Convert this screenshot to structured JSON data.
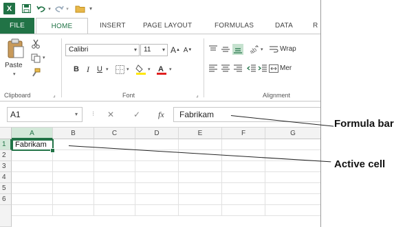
{
  "qat": {
    "app_icon": "X",
    "save_icon": "save-icon",
    "undo_icon": "undo-icon",
    "redo_icon": "redo-icon",
    "open_icon": "folder-icon"
  },
  "tabs": [
    "FILE",
    "HOME",
    "INSERT",
    "PAGE LAYOUT",
    "FORMULAS",
    "DATA",
    "R"
  ],
  "ribbon": {
    "paste_label": "Paste",
    "font_name": "Calibri",
    "font_size": "11",
    "grow_font": "A",
    "shrink_font": "A",
    "bold": "B",
    "italic": "I",
    "underline": "U",
    "wrap_text": "Wrap",
    "merge": "Mer",
    "groups": {
      "clipboard": "Clipboard",
      "font": "Font",
      "alignment": "Alignment"
    }
  },
  "formula_bar": {
    "name_box": "A1",
    "cancel": "✕",
    "enter": "✓",
    "fx": "fx",
    "content": "Fabrikam"
  },
  "grid": {
    "columns": [
      "A",
      "B",
      "C",
      "D",
      "E",
      "F",
      "G"
    ],
    "rows": [
      "1",
      "2",
      "3",
      "4",
      "5",
      "6"
    ],
    "a1_value": "Fabrikam"
  },
  "callouts": {
    "formula_bar": "Formula bar",
    "active_cell": "Active cell"
  },
  "colors": {
    "excel_green": "#217346",
    "selected_header_bg": "#d3e8d9"
  }
}
